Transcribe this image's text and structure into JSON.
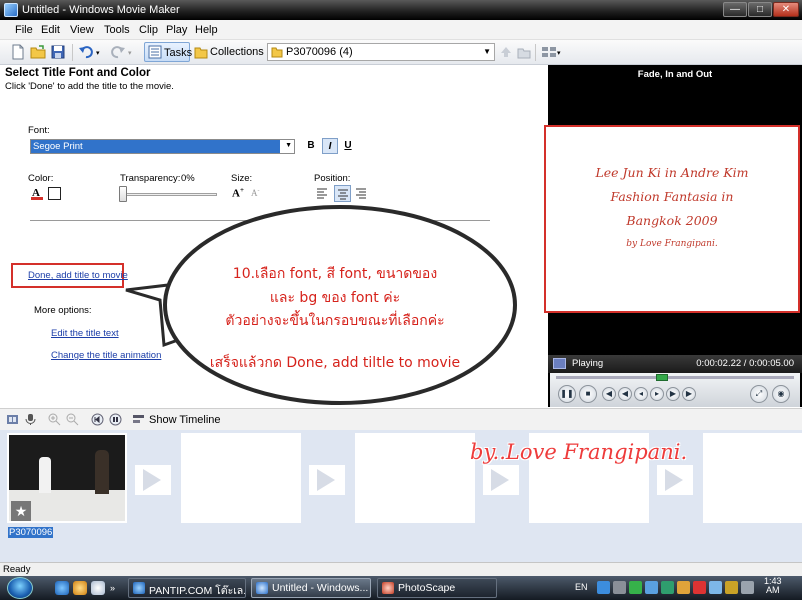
{
  "window": {
    "title": "Untitled - Windows Movie Maker",
    "buttons": {
      "minimize": "—",
      "maximize": "□",
      "close": "✕"
    }
  },
  "menu": [
    "File",
    "Edit",
    "View",
    "Tools",
    "Clip",
    "Play",
    "Help"
  ],
  "toolbar": {
    "tasks_label": "Tasks",
    "collections_label": "Collections",
    "collection_value": "P3070096 (4)"
  },
  "task_pane": {
    "heading": "Select Title Font and Color",
    "instruction": "Click 'Done' to add the title to the movie.",
    "font_label": "Font:",
    "font_value": "Segoe Print",
    "bold": "B",
    "italic": "I",
    "underline": "U",
    "color_label": "Color:",
    "transparency_label": "Transparency:",
    "transparency_value": "0%",
    "transparency_level": 0,
    "size_label": "Size:",
    "position_label": "Position:",
    "done_link": "Done, add title to movie",
    "more_options_label": "More options:",
    "edit_text_link": "Edit the title text",
    "change_animation_link": "Change the title animation"
  },
  "callout": {
    "lines": [
      "10.เลือก font, สี font, ขนาดของ",
      "และ bg ของ font ค่ะ",
      "ตัวอย่างจะขึ้นในกรอบขณะที่เลือกค่ะ",
      "เสร็จแล้วกด Done, add tiltle to movie"
    ],
    "color": "#d6221b"
  },
  "preview": {
    "header": "Fade, In and Out",
    "title_lines": [
      "Lee Jun Ki in Andre Kim",
      "Fashion Fantasia in",
      "Bangkok 2009"
    ],
    "credit": "by Love Frangipani.",
    "status": "Playing",
    "time": "0:00:02.22 / 0:00:05.00",
    "progress": 0.444,
    "title_color": "#c0392b"
  },
  "timeline": {
    "show_timeline_label": "Show Timeline",
    "clip_label": "P3070096",
    "watermark": "by..Love Frangipani."
  },
  "statusbar": {
    "text": "Ready"
  },
  "taskbar": {
    "buttons": [
      "PANTIP.COM โต๊ะเล...",
      "Untitled - Windows...",
      "PhotoScape"
    ],
    "language": "EN",
    "clock_time": "1:43",
    "clock_ampm": "AM"
  },
  "colors": {
    "accent": "#3173ca",
    "highlight_border": "#d4302a",
    "link": "#1c3ea8"
  },
  "icons": [
    "new-project-icon",
    "open-project-icon",
    "save-icon",
    "undo-icon",
    "redo-icon",
    "tasks-icon",
    "collections-icon",
    "play-icon",
    "stop-icon",
    "fullscreen-icon",
    "search-icon",
    "zoom-in-icon",
    "zoom-out-icon",
    "start-icon"
  ]
}
